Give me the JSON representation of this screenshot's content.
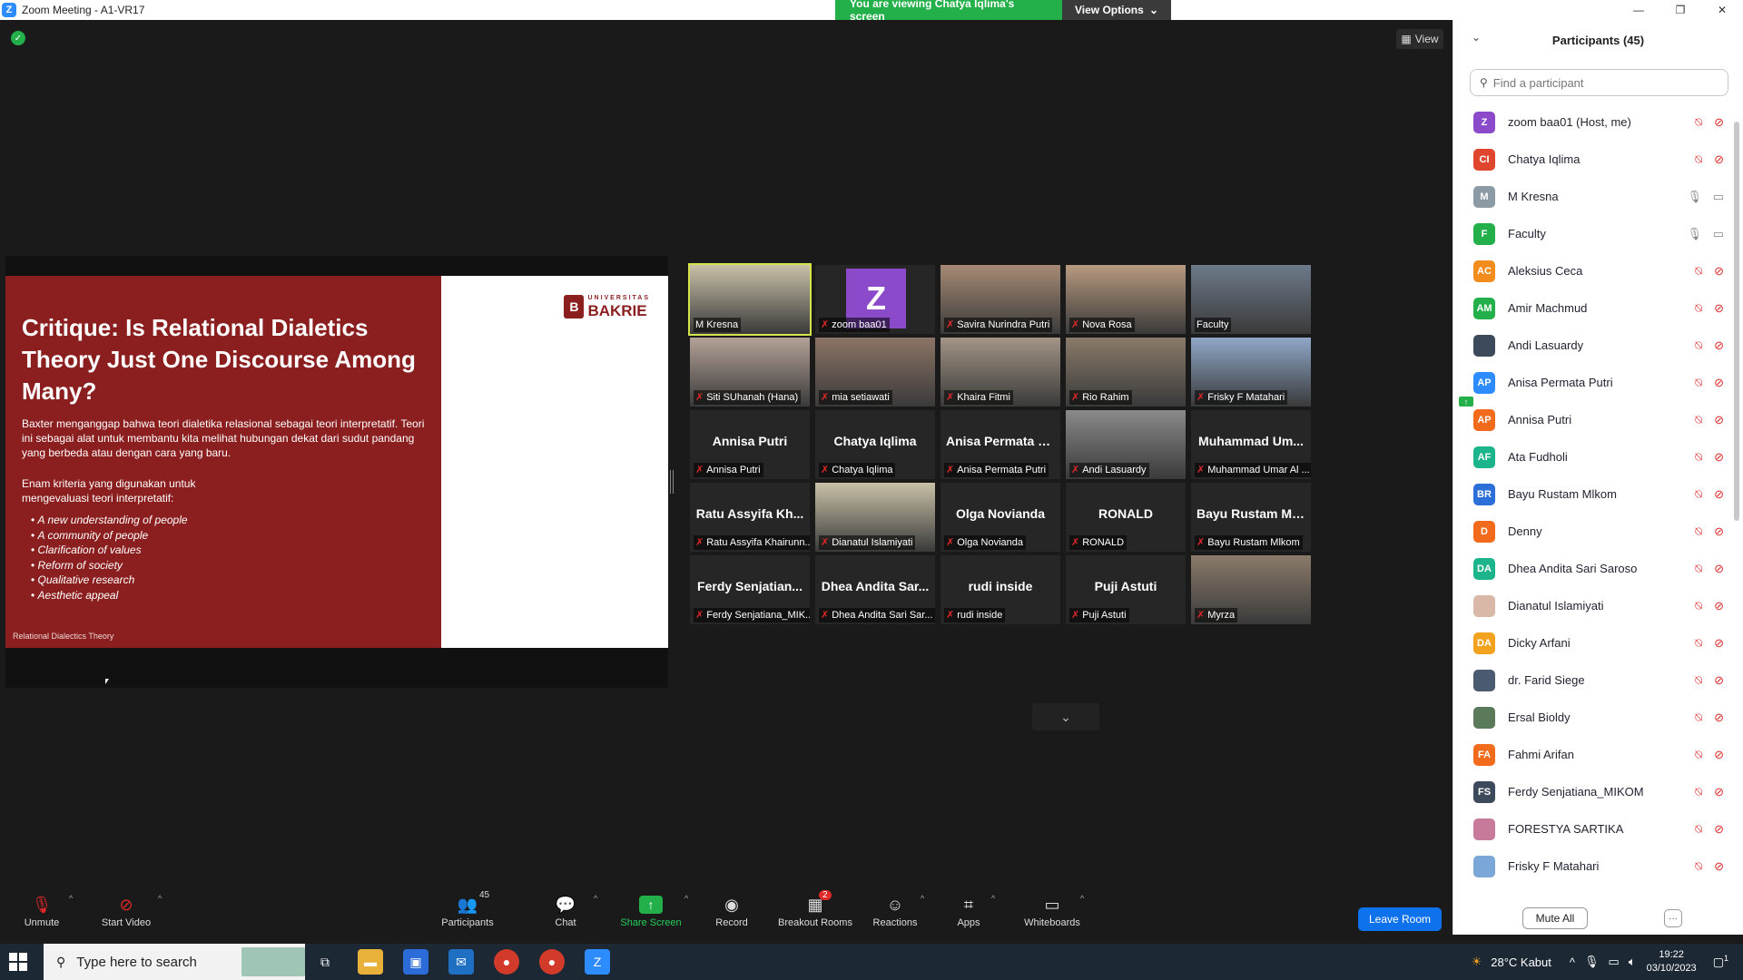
{
  "window": {
    "title": "Zoom Meeting - A1-VR17",
    "viewing_banner": "You are viewing Chatya Iqlima's screen",
    "view_options": "View Options"
  },
  "stage": {
    "view_label": "View"
  },
  "slide": {
    "title": "Critique: Is Relational Dialetics Theory Just One Discourse Among Many?",
    "p1": "Baxter menganggap bahwa teori dialetika relasional sebagai teori interpretatif. Teori ini sebagai alat untuk membantu kita melihat hubungan dekat dari sudut pandang yang berbeda atau dengan cara yang baru.",
    "p2": "Enam kriteria yang digunakan untuk mengevaluasi teori interpretatif:",
    "criteria": [
      "A new understanding of people",
      "A community of people",
      "Clarification of values",
      "Reform of society",
      "Qualitative research",
      "Aesthetic appeal"
    ],
    "footer": "Relational Dialectics Theory",
    "logo_small": "UNIVERSITAS",
    "logo_big": "BAKRIE",
    "logo_mark": "B"
  },
  "gallery": [
    {
      "name": "M Kresna",
      "big": "",
      "type": "photo",
      "active": true,
      "muted": false
    },
    {
      "name": "zoom baa01",
      "big": "Z",
      "type": "avatar",
      "active": false,
      "muted": true
    },
    {
      "name": "Savira Nurindra Putri",
      "big": "",
      "type": "photo",
      "active": false,
      "muted": true
    },
    {
      "name": "Nova Rosa",
      "big": "",
      "type": "photo",
      "active": false,
      "muted": true
    },
    {
      "name": "Faculty",
      "big": "",
      "type": "photo",
      "active": false,
      "muted": false
    },
    {
      "name": "Siti SUhanah (Hana)",
      "big": "",
      "type": "photo",
      "active": false,
      "muted": true
    },
    {
      "name": "mia setiawati",
      "big": "",
      "type": "photo",
      "active": false,
      "muted": true
    },
    {
      "name": "Khaira Fitmi",
      "big": "",
      "type": "photo",
      "active": false,
      "muted": true
    },
    {
      "name": "Rio Rahim",
      "big": "",
      "type": "photo",
      "active": false,
      "muted": true
    },
    {
      "name": "Frisky F Matahari",
      "big": "",
      "type": "photo",
      "active": false,
      "muted": true
    },
    {
      "name": "Annisa Putri",
      "big": "Annisa Putri",
      "type": "name",
      "active": false,
      "muted": true
    },
    {
      "name": "Chatya Iqlima",
      "big": "Chatya Iqlima",
      "type": "name",
      "active": false,
      "muted": true
    },
    {
      "name": "Anisa Permata Putri",
      "big": "Anisa Permata P...",
      "type": "name",
      "active": false,
      "muted": true
    },
    {
      "name": "Andi Lasuardy",
      "big": "",
      "type": "photo",
      "active": false,
      "muted": true
    },
    {
      "name": "Muhammad Umar Al ...",
      "big": "Muhammad Um...",
      "type": "name",
      "active": false,
      "muted": true
    },
    {
      "name": "Ratu Assyifa Khairunn...",
      "big": "Ratu Assyifa Kh...",
      "type": "name",
      "active": false,
      "muted": true
    },
    {
      "name": "Dianatul Islamiyati",
      "big": "",
      "type": "photo",
      "active": false,
      "muted": true
    },
    {
      "name": "Olga Novianda",
      "big": "Olga Novianda",
      "type": "name",
      "active": false,
      "muted": true
    },
    {
      "name": "RONALD",
      "big": "RONALD",
      "type": "name",
      "active": false,
      "muted": true
    },
    {
      "name": "Bayu Rustam Mlkom",
      "big": "Bayu Rustam Ml...",
      "type": "name",
      "active": false,
      "muted": true
    },
    {
      "name": "Ferdy Senjatiana_MIK...",
      "big": "Ferdy Senjatian...",
      "type": "name",
      "active": false,
      "muted": true
    },
    {
      "name": "Dhea Andita Sari Sar...",
      "big": "Dhea Andita Sar...",
      "type": "name",
      "active": false,
      "muted": true
    },
    {
      "name": "rudi inside",
      "big": "rudi inside",
      "type": "name",
      "active": false,
      "muted": true
    },
    {
      "name": "Puji Astuti",
      "big": "Puji Astuti",
      "type": "name",
      "active": false,
      "muted": true
    },
    {
      "name": "Myrza",
      "big": "",
      "type": "photo",
      "active": false,
      "muted": true
    }
  ],
  "participants": {
    "title": "Participants (45)",
    "search_placeholder": "Find a participant",
    "list": [
      {
        "initials": "Z",
        "name": "zoom baa01 (Host, me)",
        "color": "#8a4ac9",
        "mic": "off",
        "cam": "off",
        "sharing": false
      },
      {
        "initials": "CI",
        "name": "Chatya Iqlima",
        "color": "#e0452d",
        "mic": "off",
        "cam": "off",
        "sharing": true
      },
      {
        "initials": "M",
        "name": "M Kresna",
        "color": "#8c9aa5",
        "mic": "on",
        "cam": "on",
        "sharing": false
      },
      {
        "initials": "F",
        "name": "Faculty",
        "color": "#23b04a",
        "mic": "on",
        "cam": "on",
        "sharing": false
      },
      {
        "initials": "AC",
        "name": "Aleksius Ceca",
        "color": "#f28c1c",
        "mic": "off",
        "cam": "off",
        "sharing": false
      },
      {
        "initials": "AM",
        "name": "Amir Machmud",
        "color": "#23b04a",
        "mic": "off",
        "cam": "off",
        "sharing": false
      },
      {
        "initials": "",
        "name": "Andi Lasuardy",
        "color": "#3d4a5c",
        "mic": "off",
        "cam": "off",
        "sharing": false
      },
      {
        "initials": "AP",
        "name": "Anisa Permata Putri",
        "color": "#2d8cff",
        "mic": "off",
        "cam": "off",
        "sharing": false
      },
      {
        "initials": "AP",
        "name": "Annisa Putri",
        "color": "#f26b1c",
        "mic": "off",
        "cam": "off",
        "sharing": false
      },
      {
        "initials": "AF",
        "name": "Ata Fudholi",
        "color": "#1cb48a",
        "mic": "off",
        "cam": "off",
        "sharing": false
      },
      {
        "initials": "BR",
        "name": "Bayu Rustam Mlkom",
        "color": "#2d6fd8",
        "mic": "off",
        "cam": "off",
        "sharing": false
      },
      {
        "initials": "D",
        "name": "Denny",
        "color": "#f26b1c",
        "mic": "off",
        "cam": "off",
        "sharing": false
      },
      {
        "initials": "DA",
        "name": "Dhea Andita Sari Saroso",
        "color": "#1cb48a",
        "mic": "off",
        "cam": "off",
        "sharing": false
      },
      {
        "initials": "",
        "name": "Dianatul Islamiyati",
        "color": "#d9b8a8",
        "mic": "off",
        "cam": "off",
        "sharing": false
      },
      {
        "initials": "DA",
        "name": "Dicky Arfani",
        "color": "#f2a21c",
        "mic": "off",
        "cam": "off",
        "sharing": false
      },
      {
        "initials": "",
        "name": "dr. Farid Siege",
        "color": "#4a5a70",
        "mic": "off",
        "cam": "off",
        "sharing": false
      },
      {
        "initials": "",
        "name": "Ersal Bioldy",
        "color": "#5a7a5a",
        "mic": "off",
        "cam": "off",
        "sharing": false
      },
      {
        "initials": "FA",
        "name": "Fahmi Arifan",
        "color": "#f26b1c",
        "mic": "off",
        "cam": "off",
        "sharing": false
      },
      {
        "initials": "FS",
        "name": "Ferdy Senjatiana_MIKOM",
        "color": "#3d4a5c",
        "mic": "off",
        "cam": "off",
        "sharing": false
      },
      {
        "initials": "",
        "name": "FORESTYA SARTIKA",
        "color": "#c87a9a",
        "mic": "off",
        "cam": "off",
        "sharing": false
      },
      {
        "initials": "",
        "name": "Frisky F Matahari",
        "color": "#7aa7d8",
        "mic": "off",
        "cam": "off",
        "sharing": false
      }
    ],
    "mute_all": "Mute All",
    "more": "···"
  },
  "toolbar": {
    "unmute": "Unmute",
    "start_video": "Start Video",
    "participants": "Participants",
    "participants_count": "45",
    "chat": "Chat",
    "share_screen": "Share Screen",
    "record": "Record",
    "breakout_rooms": "Breakout Rooms",
    "breakout_badge": "2",
    "reactions": "Reactions",
    "apps": "Apps",
    "whiteboards": "Whiteboards",
    "leave_room": "Leave Room"
  },
  "taskbar": {
    "search_placeholder": "Type here to search",
    "weather": "28°C  Kabut",
    "time": "19:22",
    "date": "03/10/2023",
    "notif_count": "1"
  }
}
